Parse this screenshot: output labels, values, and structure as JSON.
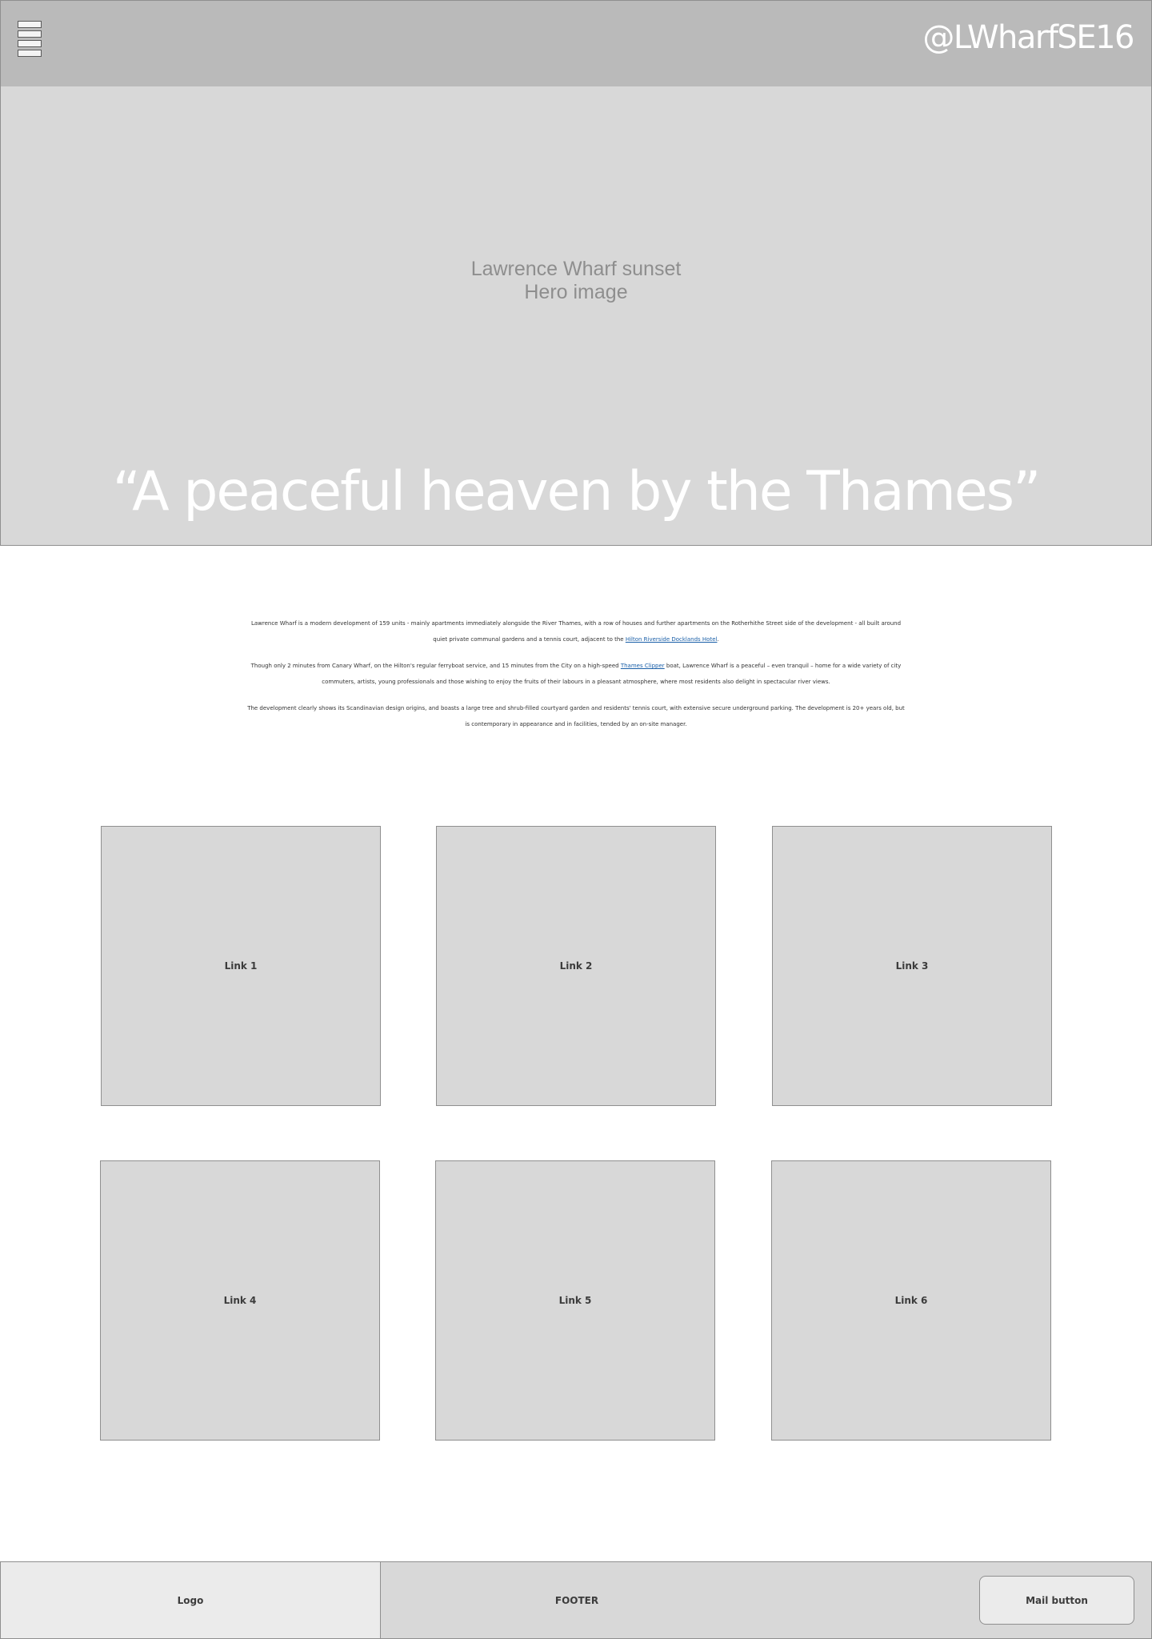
{
  "header": {
    "menu_icon": "hamburger-menu-icon",
    "handle": "@LWharfSE16",
    "colors": {
      "background": "#bababa",
      "handle_text": "#ffffff"
    }
  },
  "hero": {
    "label_line1": "Lawrence Wharf sunset",
    "label_line2": "Hero image",
    "quote": "“A peaceful heaven by the Thames”",
    "colors": {
      "background": "#d8d8d8",
      "label": "#8e8e8e",
      "quote": "#ffffff"
    }
  },
  "intro": {
    "p1_before": "Lawrence Wharf is a modern development of 159 units - mainly apartments immediately alongside the River Thames, with a row of houses and further apartments on the Rotherhithe Street side of the development - all built around quiet private communal gardens and a tennis court, adjacent to the ",
    "p1_link": "Hilton Riverside Docklands Hotel",
    "p1_after": ".",
    "p2_before": "Though only 2 minutes from Canary Wharf, on the Hilton's regular ferryboat service, and 15 minutes from the City on a high-speed ",
    "p2_link": "Thames Clipper",
    "p2_after": " boat, Lawrence Wharf is a peaceful – even tranquil – home for a wide variety of city commuters, artists, young professionals and those wishing to enjoy the fruits of their labours in a pleasant atmosphere, where most residents also delight in spectacular river views.",
    "p3": "The development clearly shows its Scandinavian design origins, and boasts a large tree and shrub-filled courtyard garden and residents' tennis court, with extensive secure underground parking. The development is 20+ years old, but is contemporary in appearance and in facilities, tended by an on-site manager.",
    "colors": {
      "text": "#333333",
      "link": "#1a5fa8"
    }
  },
  "tiles": [
    {
      "label": "Link 1"
    },
    {
      "label": "Link 2"
    },
    {
      "label": "Link 3"
    },
    {
      "label": "Link 4"
    },
    {
      "label": "Link 5"
    },
    {
      "label": "Link 6"
    }
  ],
  "footer": {
    "logo": "Logo",
    "label": "FOOTER",
    "mail_button": "Mail button",
    "colors": {
      "background": "#d8d8d8",
      "logo_background": "#ebebeb"
    }
  }
}
